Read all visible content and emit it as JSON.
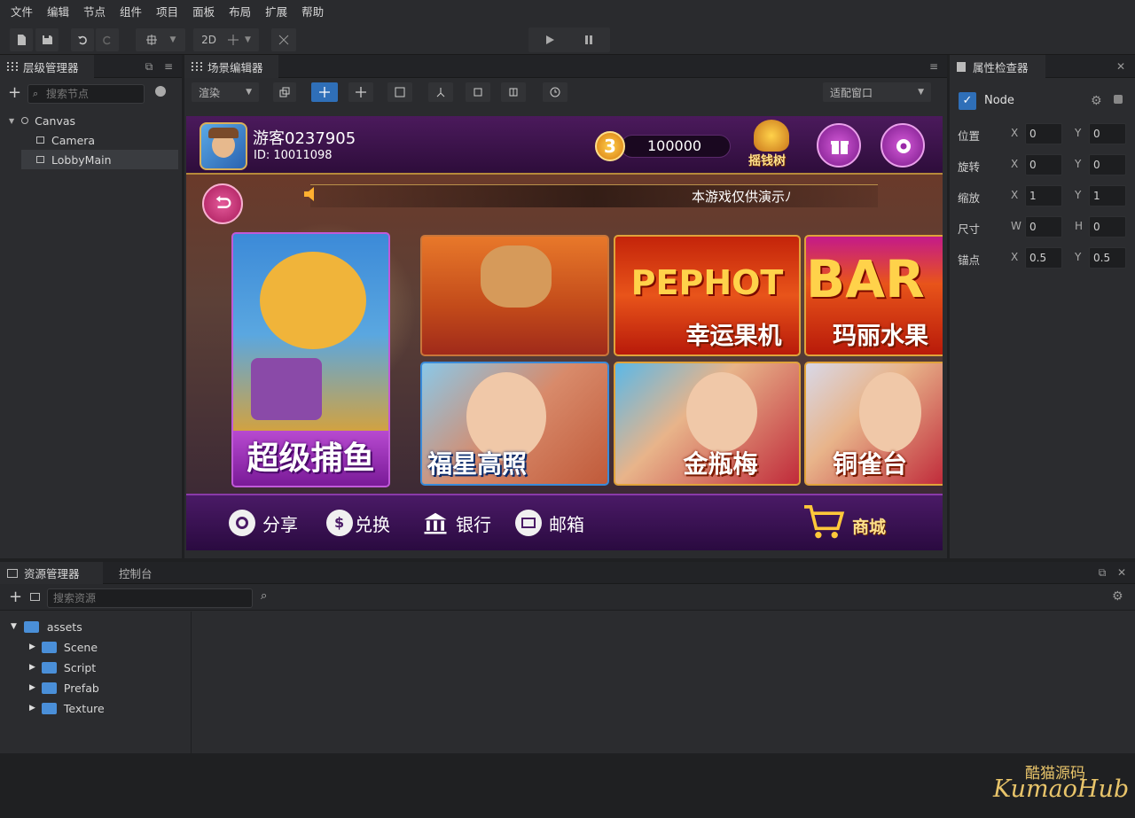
{
  "menu": [
    "文件",
    "编辑",
    "节点",
    "组件",
    "项目",
    "面板",
    "布局",
    "扩展",
    "帮助"
  ],
  "toolbar": {
    "mode_2d": "2D"
  },
  "hierarchy": {
    "title": "层级管理器",
    "search_placeholder": "搜索节点",
    "nodes": [
      "Canvas",
      "Camera",
      "LobbyMain"
    ]
  },
  "scene": {
    "title": "场景编辑器",
    "render_select": "渲染",
    "fit_select": "适配窗口"
  },
  "inspector": {
    "title": "属性检查器",
    "node_name": "Node",
    "props": [
      {
        "label": "位置",
        "a_label": "X",
        "a": "0",
        "b_label": "Y",
        "b": "0"
      },
      {
        "label": "旋转",
        "a_label": "X",
        "a": "0",
        "b_label": "Y",
        "b": "0"
      },
      {
        "label": "缩放",
        "a_label": "X",
        "a": "1",
        "b_label": "Y",
        "b": "1"
      },
      {
        "label": "尺寸",
        "a_label": "W",
        "a": "0",
        "b_label": "H",
        "b": "0"
      },
      {
        "label": "锚点",
        "a_label": "X",
        "a": "0.5",
        "b_label": "Y",
        "b": "0.5"
      }
    ]
  },
  "game": {
    "username": "游客0237905",
    "user_id": "ID: 10011098",
    "coins": "100000",
    "money_tree": "摇钱树",
    "notice": "本游戏仅供演示ﾉ",
    "tiles": [
      "超级捕鱼",
      "幸运果机",
      "玛丽水果",
      "福星高照",
      "金瓶梅",
      "铜雀台"
    ],
    "tile_art_text": [
      "PEPHOT",
      "BAR"
    ],
    "bottom": [
      "分享",
      "兑换",
      "银行",
      "邮箱"
    ],
    "shop": "商城"
  },
  "assets": {
    "tab_assets": "资源管理器",
    "tab_console": "控制台",
    "search_placeholder": "搜索资源",
    "root": "assets",
    "folders": [
      "Scene",
      "Script",
      "Prefab",
      "Texture"
    ]
  },
  "watermark": {
    "cn": "酷猫源码",
    "en": "KumaoHub"
  },
  "colors": {
    "accent_blue": "#2f6fb8",
    "folder_blue": "#4a8fd8",
    "game_purple": "#3a1446"
  }
}
